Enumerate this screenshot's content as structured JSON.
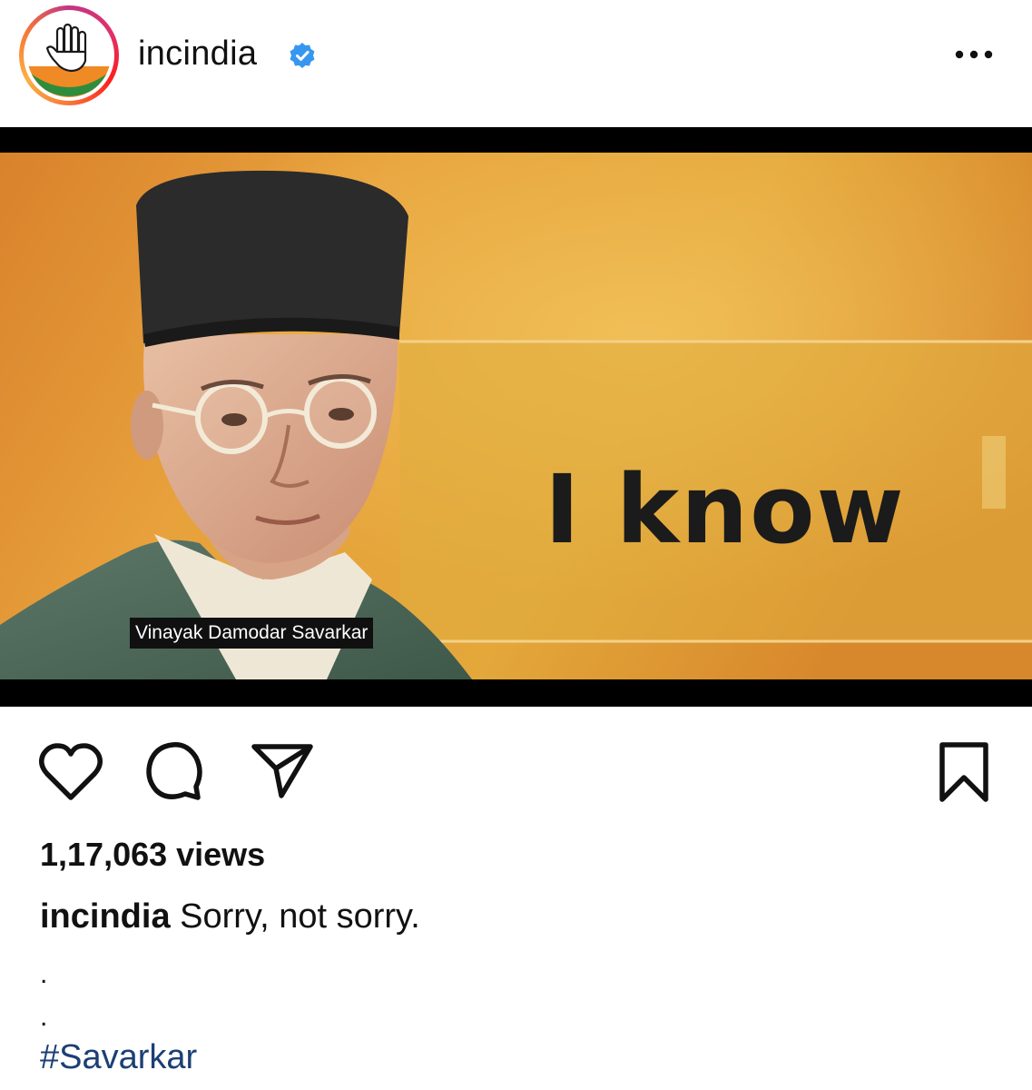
{
  "header": {
    "username": "incindia",
    "verified": true,
    "more_icon": "ellipsis-icon"
  },
  "media": {
    "person_label": "Vinayak Damodar Savarkar",
    "overlay_text": "I know"
  },
  "actions": {
    "like_icon": "heart-icon",
    "comment_icon": "comment-icon",
    "share_icon": "send-icon",
    "save_icon": "bookmark-icon"
  },
  "post": {
    "views": "1,17,063 views",
    "caption_user": "incindia",
    "caption_text": " Sorry, not sorry.",
    "dot1": ".",
    "dot2": ".",
    "hashtag": "#Savarkar"
  },
  "colors": {
    "hashtag": "#1c3f74",
    "verified": "#3797f0",
    "saffron": "#f08a24",
    "green": "#2f8c3d"
  }
}
